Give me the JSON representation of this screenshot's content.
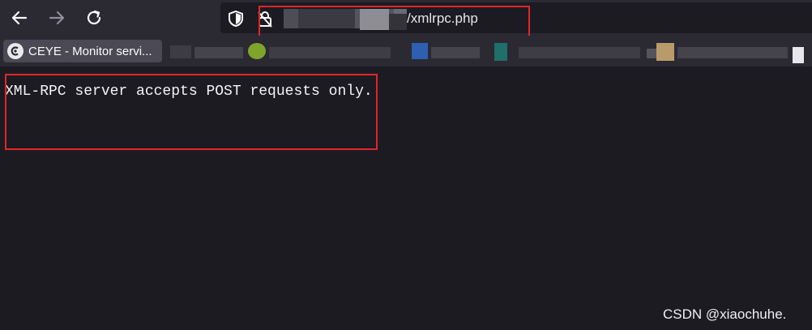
{
  "browser": {
    "url_suffix": "/xmlrpc.php",
    "bookmarks": [
      {
        "label": "CEYE - Monitor servi..."
      }
    ]
  },
  "page": {
    "message": "XML-RPC server accepts POST requests only."
  },
  "watermark": "CSDN @xiaochuhe.",
  "colors": {
    "toolbar": "#2b2a33",
    "page_background": "#1c1b22",
    "highlight_box": "#e0262a"
  }
}
